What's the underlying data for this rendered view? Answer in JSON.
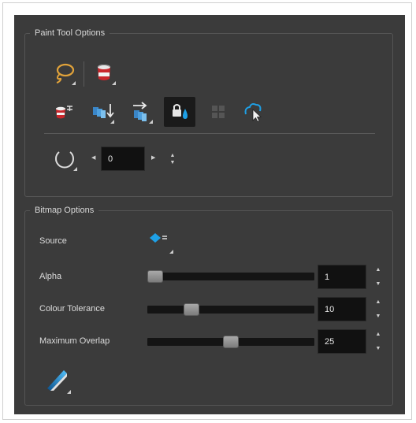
{
  "paint_tool_options": {
    "title": "Paint Tool Options",
    "tools": [
      {
        "name": "lasso-icon"
      },
      {
        "name": "paint-bucket-icon"
      }
    ],
    "mode_buttons": [
      {
        "name": "paint-unpainted-icon"
      },
      {
        "name": "apply-to-layers-below-icon"
      },
      {
        "name": "apply-to-layers-right-icon"
      },
      {
        "name": "respect-protected-colour-icon",
        "active": true
      },
      {
        "name": "grid-disabled-icon"
      },
      {
        "name": "select-colour-icon"
      }
    ],
    "brush_size_value": "0"
  },
  "bitmap_options": {
    "title": "Bitmap Options",
    "source_label": "Source",
    "alpha": {
      "label": "Alpha",
      "value": "1",
      "level": 0.0
    },
    "colour_tolerance": {
      "label": "Colour Tolerance",
      "value": "10",
      "level": 0.24
    },
    "maximum_overlap": {
      "label": "Maximum Overlap",
      "value": "25",
      "level": 0.5
    }
  },
  "colors": {
    "panel_bg": "#3b3b3b",
    "accent_blue": "#1ea0e6",
    "paint_red": "#c9262b"
  }
}
